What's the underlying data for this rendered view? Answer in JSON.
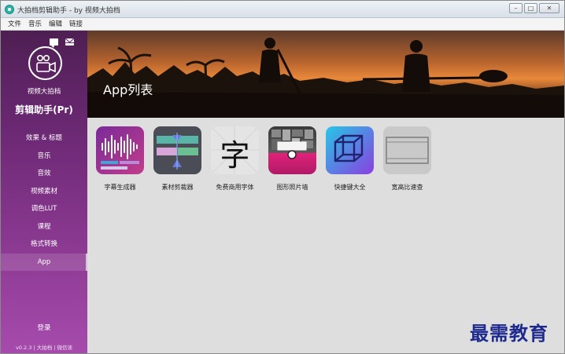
{
  "window": {
    "title": "大拍档剪辑助手 - by 视频大拍档",
    "controls": [
      "–",
      "□",
      "✕"
    ]
  },
  "menu": [
    "文件",
    "音乐",
    "编辑",
    "链接"
  ],
  "sidebar": {
    "brand_sub": "视频大拍档",
    "brand_main": "剪辑助手(Pr)",
    "items": [
      {
        "label": "效果 & 标题"
      },
      {
        "label": "音乐"
      },
      {
        "label": "音效"
      },
      {
        "label": "视频素材"
      },
      {
        "label": "调色LUT"
      },
      {
        "label": "课程"
      },
      {
        "label": "格式转换"
      },
      {
        "label": "App",
        "active": true
      }
    ],
    "login": "登录",
    "footer": "v0.2.3 | 大拍档 | 微信读"
  },
  "main": {
    "title": "App列表",
    "apps": [
      {
        "label": "字幕生成器",
        "icon": "waveform-icon"
      },
      {
        "label": "素材剪裁器",
        "icon": "crop-icon"
      },
      {
        "label": "免费商用字体",
        "icon": "font-icon",
        "glyph": "字"
      },
      {
        "label": "图形照片墙",
        "icon": "photo-wall-icon"
      },
      {
        "label": "快捷键大全",
        "icon": "cube-icon"
      },
      {
        "label": "宽高比速查",
        "icon": "aspect-ratio-icon"
      }
    ]
  },
  "watermark": "最需教育",
  "colors": {
    "sidebar_top": "#4e1f53",
    "sidebar_bottom": "#a64bad",
    "sunset": "#e9893a"
  }
}
